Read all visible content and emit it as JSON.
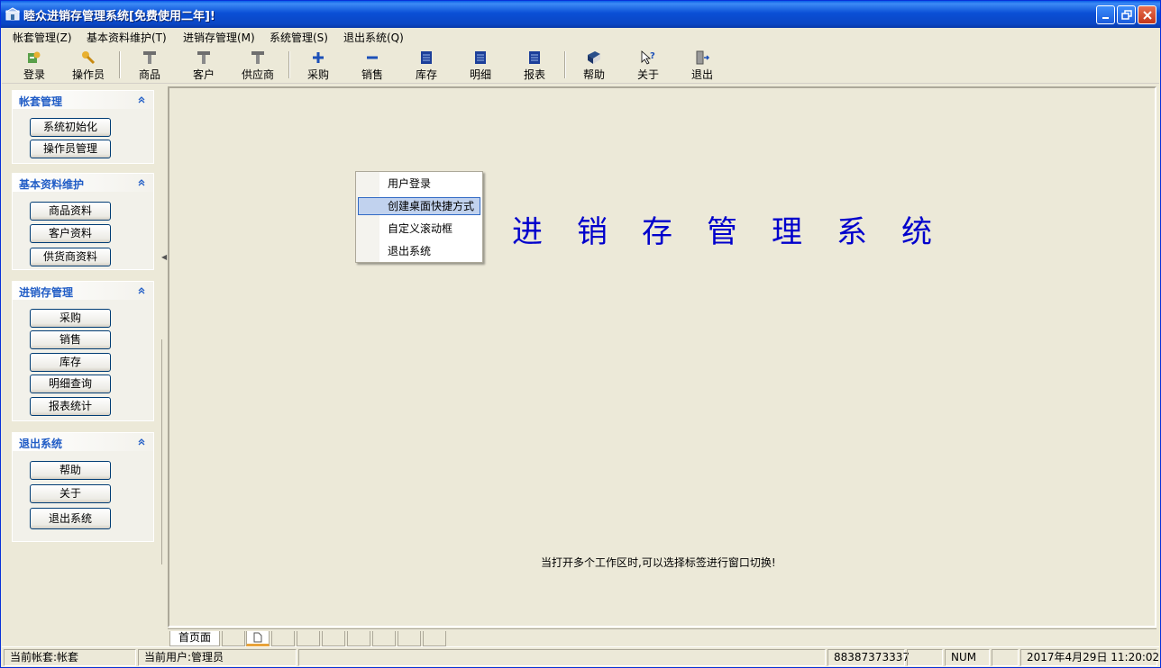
{
  "window": {
    "title": "睦众进销存管理系统[免费使用二年]!",
    "colors": {
      "title_bar": "#0a4fd6",
      "accent": "#215dc6",
      "big_title": "#0000cc"
    }
  },
  "menubar": {
    "items": [
      {
        "label": "帐套管理(Z)"
      },
      {
        "label": "基本资料维护(T)"
      },
      {
        "label": "进销存管理(M)"
      },
      {
        "label": "系统管理(S)"
      },
      {
        "label": "退出系统(Q)"
      }
    ]
  },
  "toolbar": {
    "items": [
      {
        "label": "登录",
        "icon": "login-icon"
      },
      {
        "label": "操作员",
        "icon": "key-icon"
      },
      {
        "label": "商品",
        "icon": "hammer-icon"
      },
      {
        "label": "客户",
        "icon": "hammer-icon"
      },
      {
        "label": "供应商",
        "icon": "hammer-icon"
      },
      {
        "label": "采购",
        "icon": "plus-icon"
      },
      {
        "label": "销售",
        "icon": "minus-icon"
      },
      {
        "label": "库存",
        "icon": "table-icon"
      },
      {
        "label": "明细",
        "icon": "table-icon"
      },
      {
        "label": "报表",
        "icon": "table-icon"
      },
      {
        "label": "帮助",
        "icon": "book-icon"
      },
      {
        "label": "关于",
        "icon": "help-cursor-icon"
      },
      {
        "label": "退出",
        "icon": "exit-door-icon"
      }
    ]
  },
  "sidebar": {
    "groups": [
      {
        "title": "帐套管理",
        "buttons": [
          "系统初始化",
          "操作员管理"
        ]
      },
      {
        "title": "基本资料维护",
        "buttons": [
          "商品资料",
          "客户资料",
          "供货商资料"
        ]
      },
      {
        "title": "进销存管理",
        "buttons": [
          "采购",
          "销售",
          "库存",
          "明细查询",
          "报表统计"
        ]
      },
      {
        "title": "退出系统",
        "buttons": [
          "帮助",
          "关于",
          "退出系统"
        ]
      }
    ]
  },
  "main": {
    "big_title": "进销存管理系统",
    "hint": "当打开多个工作区时,可以选择标签进行窗口切换!"
  },
  "context_menu": {
    "items": [
      {
        "label": "用户登录",
        "selected": false
      },
      {
        "label": "创建桌面快捷方式",
        "selected": true
      },
      {
        "label": "自定义滚动框",
        "selected": false
      },
      {
        "label": "退出系统",
        "selected": false
      }
    ]
  },
  "tabs": {
    "first_label": "首页面"
  },
  "statusbar": {
    "account": "当前帐套:帐套",
    "user": "当前用户:管理员",
    "phone": "88387373337",
    "num": "NUM",
    "datetime": "2017年4月29日  11:20:02"
  }
}
